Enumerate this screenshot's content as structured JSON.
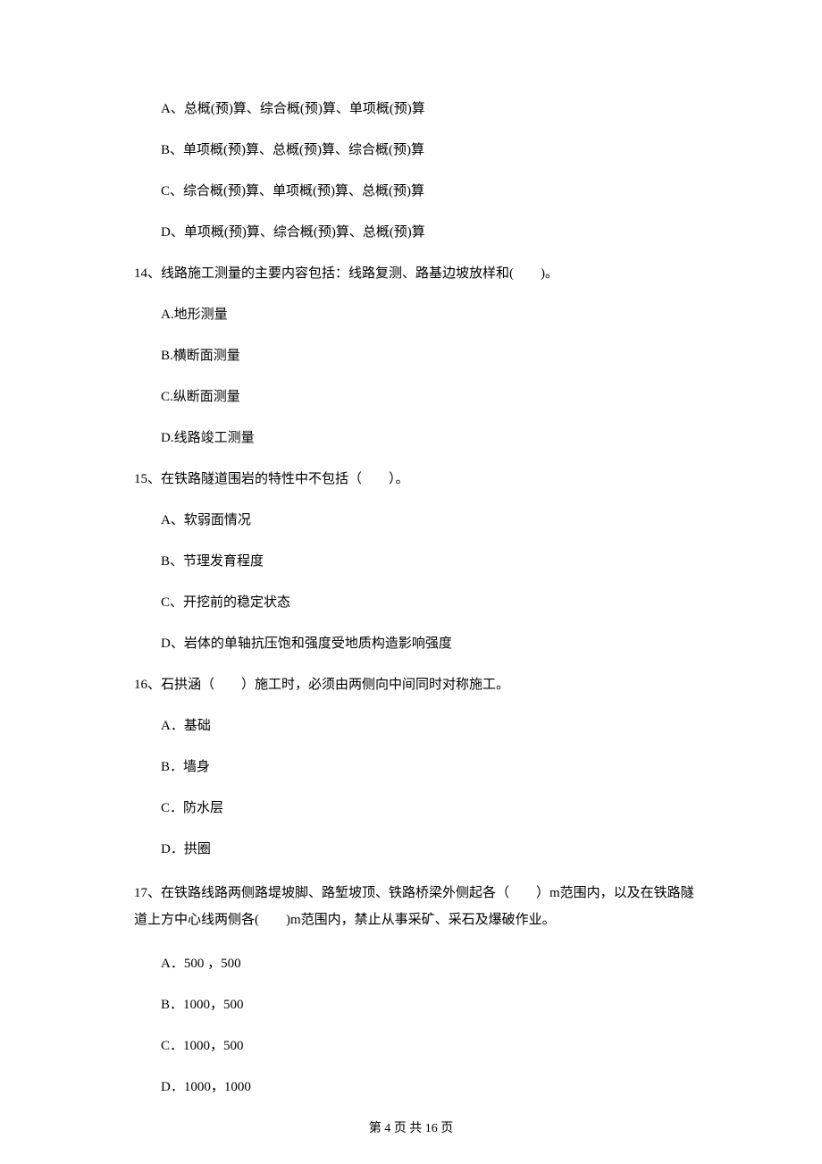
{
  "q13_options": {
    "A": "A、总概(预)算、综合概(预)算、单项概(预)算",
    "B": "B、单项概(预)算、总概(预)算、综合概(预)算",
    "C": "C、综合概(预)算、单项概(预)算、总概(预)算",
    "D": "D、单项概(预)算、综合概(预)算、总概(预)算"
  },
  "q14": {
    "stem": "14、线路施工测量的主要内容包括：线路复测、路基边坡放样和(　　)。",
    "options": {
      "A": "A.地形测量",
      "B": "B.横断面测量",
      "C": "C.纵断面测量",
      "D": "D.线路竣工测量"
    }
  },
  "q15": {
    "stem": "15、在铁路隧道围岩的特性中不包括（　　）。",
    "options": {
      "A": "A、软弱面情况",
      "B": "B、节理发育程度",
      "C": "C、开挖前的稳定状态",
      "D": "D、岩体的单轴抗压饱和强度受地质构造影响强度"
    }
  },
  "q16": {
    "stem": "16、石拱涵（　　）施工时，必须由两侧向中间同时对称施工。",
    "options": {
      "A": "A．基础",
      "B": "B．墙身",
      "C": "C．防水层",
      "D": "D．拱圈"
    }
  },
  "q17": {
    "stem": "17、在铁路线路两侧路堤坡脚、路堑坡顶、铁路桥梁外侧起各（　　）m范围内，以及在铁路隧道上方中心线两侧各(　　)m范围内，禁止从事采矿、采石及爆破作业。",
    "options": {
      "A": "A．500 ，500",
      "B": "B．1000，500",
      "C": "C．1000，500",
      "D": "D．1000，1000"
    }
  },
  "footer": "第 4 页 共 16 页"
}
